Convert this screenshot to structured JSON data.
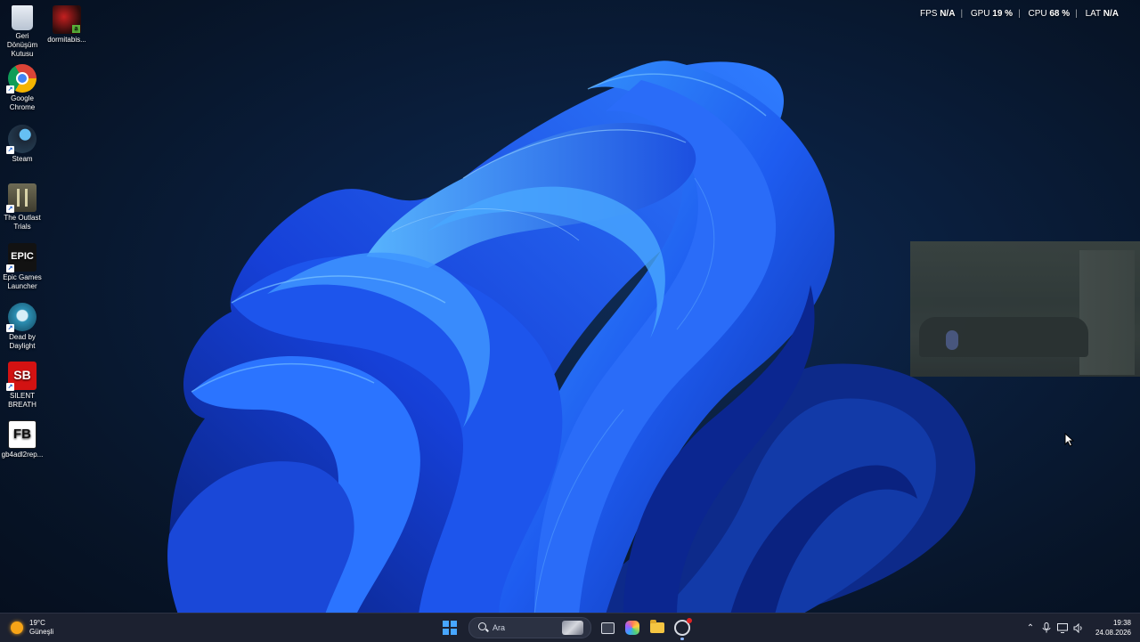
{
  "desktop": {
    "icons": [
      {
        "label": "Geri Dönüşüm Kutusu",
        "icon": "recycle-bin-icon"
      },
      {
        "label": "dormitabis...",
        "icon": "game-file-icon"
      },
      {
        "label": "Google Chrome",
        "icon": "chrome-icon"
      },
      {
        "label": "Steam",
        "icon": "steam-icon"
      },
      {
        "label": "The Outlast Trials",
        "icon": "outlast-icon"
      },
      {
        "label": "Epic Games Launcher",
        "icon": "epic-games-icon",
        "badge": "EPIC"
      },
      {
        "label": "Dead by Daylight",
        "icon": "dead-by-daylight-icon"
      },
      {
        "label": "SILENT BREATH",
        "icon": "silent-breath-icon",
        "badge": "SB"
      },
      {
        "label": "gb4adl2rep...",
        "icon": "fb-icon",
        "badge": "FB"
      }
    ]
  },
  "overlay": {
    "fps_label": "FPS",
    "fps_value": "N/A",
    "gpu_label": "GPU",
    "gpu_value": "19 %",
    "cpu_label": "CPU",
    "cpu_value": "68 %",
    "lat_label": "LAT",
    "lat_value": "N/A",
    "separator": "|"
  },
  "taskbar": {
    "weather": {
      "temp": "19°C",
      "condition": "Güneşli",
      "icon": "sun-icon"
    },
    "search_placeholder": "Ara",
    "apps": [
      "start-icon",
      "search-icon",
      "task-view-icon",
      "copilot-icon",
      "file-explorer-icon",
      "app-icon"
    ],
    "tray": {
      "icons": [
        "chevron-up-icon",
        "microphone-icon",
        "display-icon",
        "volume-icon"
      ],
      "time": "19:38",
      "date": "24.08.2026"
    }
  },
  "colors": {
    "accent": "#47a6ff",
    "taskbar_bg": "#1c2130",
    "bloom": "#1f5cf0"
  }
}
